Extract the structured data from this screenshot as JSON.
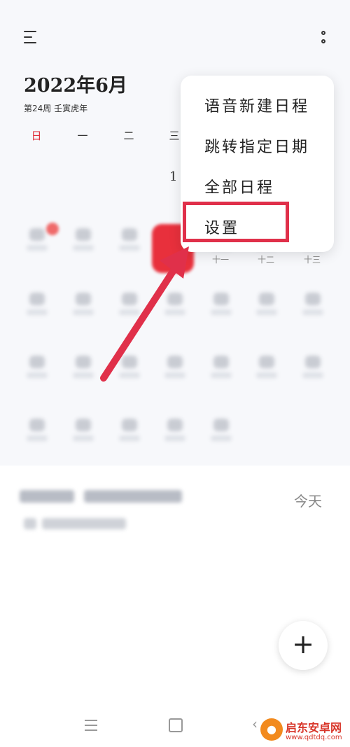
{
  "header": {
    "month_title": "2022年6月",
    "week_info": "第24周 壬寅虎年"
  },
  "weekdays": [
    "日",
    "一",
    "二",
    "三"
  ],
  "calendar": {
    "partial_day": "1",
    "lunar_labels": [
      "十一",
      "十二",
      "十三"
    ]
  },
  "popup_menu": {
    "items": [
      "语音新建日程",
      "跳转指定日期",
      "全部日程",
      "设置"
    ]
  },
  "events": {
    "today_label": "今天"
  },
  "fab": {
    "label": "+"
  },
  "watermark": {
    "title": "启东安卓网",
    "url": "www.qdtdq.com"
  },
  "colors": {
    "accent_red": "#e0303c",
    "annotation_red": "#e0304a",
    "background": "#f7f8fb"
  }
}
